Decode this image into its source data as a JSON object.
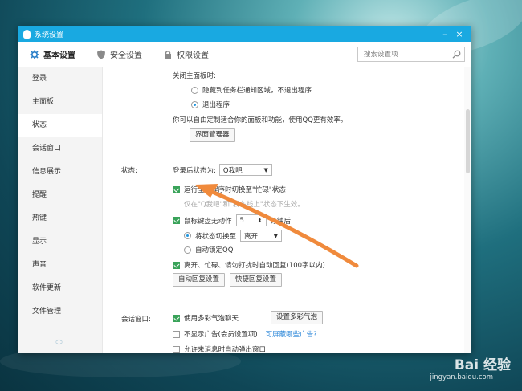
{
  "window": {
    "title": "系统设置",
    "min_symbol": "–",
    "close_symbol": "×"
  },
  "tabs": [
    {
      "label": "基本设置",
      "icon": "gear-icon"
    },
    {
      "label": "安全设置",
      "icon": "shield-icon"
    },
    {
      "label": "权限设置",
      "icon": "lock-icon"
    }
  ],
  "search": {
    "placeholder": "搜索设置项"
  },
  "sidebar": {
    "items": [
      "登录",
      "主面板",
      "状态",
      "会话窗口",
      "信息展示",
      "提醒",
      "热键",
      "显示",
      "声音",
      "软件更新",
      "文件管理"
    ],
    "active": "状态"
  },
  "main_panel": {
    "heading": "关闭主面板时:",
    "option_hide": "隐藏到任务栏通知区域，不退出程序",
    "option_exit": "退出程序",
    "note": "你可以自由定制适合你的面板和功能，使用QQ更有效率。",
    "manager_button": "界面管理器"
  },
  "status": {
    "section_label": "状态:",
    "after_login_label": "登录后状态为:",
    "after_login_value": "Q我吧",
    "fullscreen_busy": "运行全屏程序时切换至\"忙碌\"状态",
    "fullscreen_note": "仅在\"Q我吧\"和\"我在线上\"状态下生效。",
    "idle_prefix": "鼠标键盘无动作",
    "idle_minutes": "5",
    "idle_suffix": "分钟后:",
    "switch_status_label": "将状态切换至",
    "switch_status_value": "离开",
    "auto_lock": "自动锁定QQ",
    "auto_reply": "离开、忙碌、请勿打扰时自动回复(100字以内)",
    "auto_reply_button": "自动回复设置",
    "quick_reply_button": "快捷回复设置"
  },
  "chat": {
    "section_label": "会话窗口:",
    "colorful_bubble": "使用多彩气泡聊天",
    "bubble_button": "设置多彩气泡",
    "no_ads": "不显示广告(会员设置项)",
    "ads_link": "可屏蔽哪些广告?",
    "auto_popup": "允许来消息时自动弹出窗口"
  },
  "watermark": {
    "brand": "Bai 经验",
    "url": "jingyan.baidu.com"
  },
  "colors": {
    "titlebar": "#19a9e1",
    "arrow": "#f08a3c",
    "check": "#3aa35a"
  }
}
